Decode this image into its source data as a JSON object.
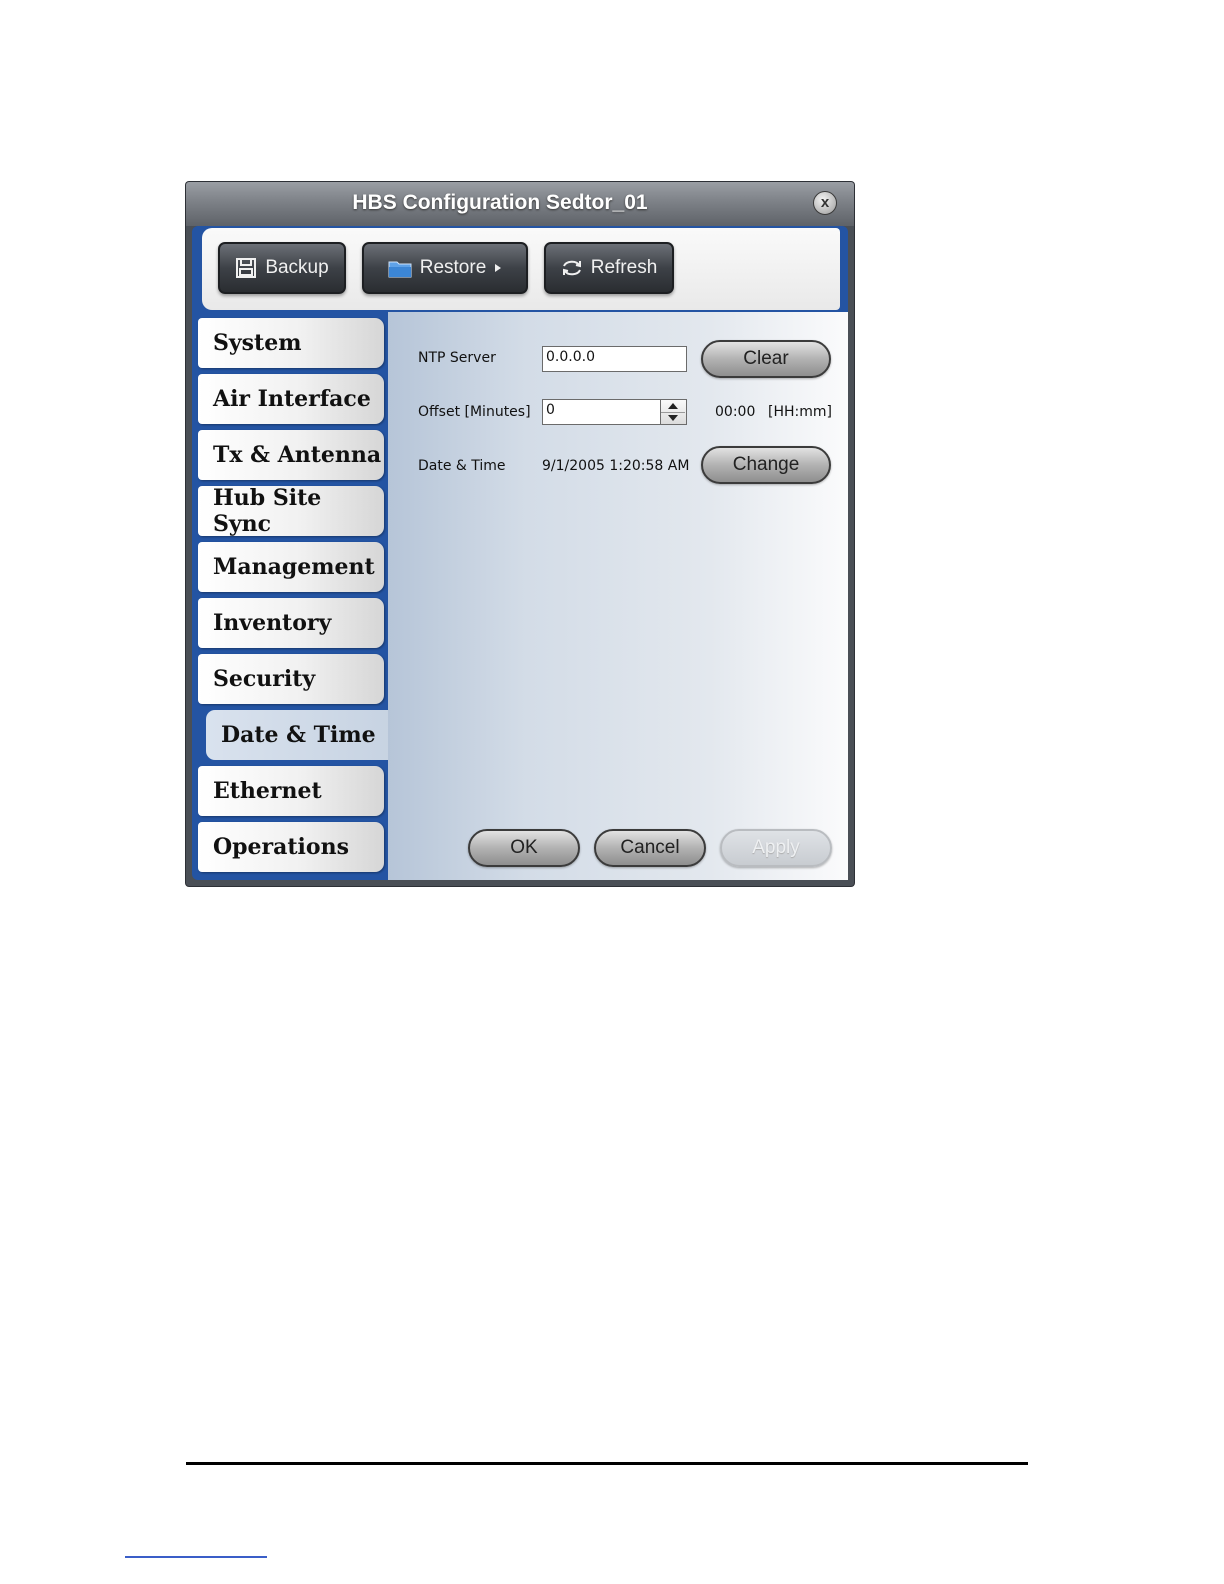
{
  "window": {
    "title": "HBS Configuration Sedtor_01",
    "close_glyph": "x"
  },
  "toolbar": {
    "backup_label": "Backup",
    "restore_label": "Restore",
    "refresh_label": "Refresh"
  },
  "nav": {
    "items": [
      {
        "label": "System",
        "active": false
      },
      {
        "label": "Air Interface",
        "active": false
      },
      {
        "label": "Tx & Antenna",
        "active": false
      },
      {
        "label": "Hub Site Sync",
        "active": false
      },
      {
        "label": "Management",
        "active": false
      },
      {
        "label": "Inventory",
        "active": false
      },
      {
        "label": "Security",
        "active": false
      },
      {
        "label": "Date & Time",
        "active": true
      },
      {
        "label": "Ethernet",
        "active": false
      },
      {
        "label": "Operations",
        "active": false
      }
    ]
  },
  "form": {
    "ntp_label": "NTP Server",
    "ntp_value": "0.0.0.0",
    "clear_label": "Clear",
    "offset_label": "Offset [Minutes]",
    "offset_value": "0",
    "offset_hhmm": "00:00",
    "offset_unit": "[HH:mm]",
    "datetime_label": "Date & Time",
    "datetime_value": "9/1/2005 1:20:58 AM",
    "change_label": "Change"
  },
  "footer": {
    "ok_label": "OK",
    "cancel_label": "Cancel",
    "apply_label": "Apply",
    "apply_enabled": false
  },
  "colors": {
    "frame_blue": "#2454a3",
    "titlebar_gray": "#7d8187",
    "content_bg": "#d3dce7"
  },
  "icons": {
    "backup": "floppy-disk-icon",
    "restore": "folder-icon",
    "restore_arrow": "caret-right-icon",
    "refresh": "refresh-arrows-icon",
    "close": "close-circle-icon"
  }
}
